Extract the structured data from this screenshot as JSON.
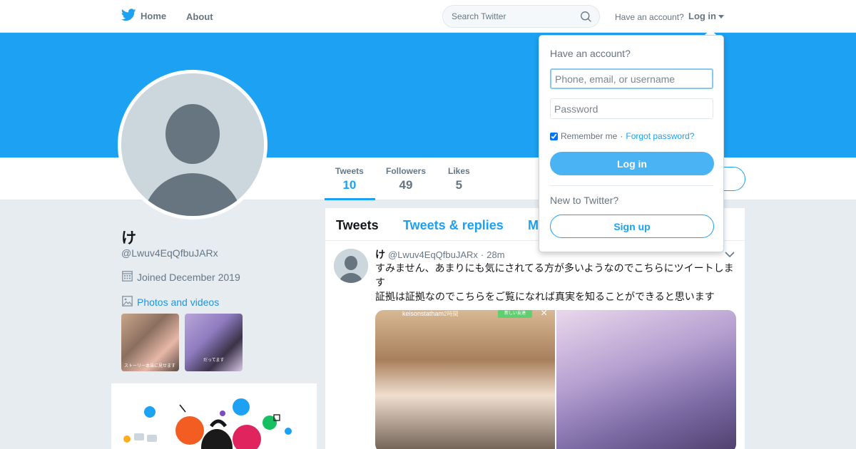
{
  "nav": {
    "home_label": "Home",
    "about_label": "About",
    "search_placeholder": "Search Twitter",
    "have_account_text": "Have an account?",
    "login_label": "Log in"
  },
  "profile": {
    "name": "け",
    "handle": "@Lwuv4EqQfbuJARx",
    "joined": "Joined December 2019",
    "photos_link": "Photos and videos",
    "thumb1_caption": "ストーリー本当に見せます",
    "thumb2_caption": "だってます"
  },
  "stats": [
    {
      "label": "Tweets",
      "value": "10"
    },
    {
      "label": "Followers",
      "value": "49"
    },
    {
      "label": "Likes",
      "value": "5"
    }
  ],
  "timeline": {
    "tabs": [
      "Tweets",
      "Tweets & replies",
      "M"
    ],
    "tweet": {
      "name": "け",
      "handle": "@Lwuv4EqQfbuJARx",
      "sep": "·",
      "time": "28m",
      "line1": "すみません、あまりにも気にされてる方が多いようなのでこちらにツイートしま",
      "line2": "す",
      "line3": "証拠は証拠なのでこちらをご覧になれば真実を知ることができると思います",
      "media_username": "keisonstatham",
      "media_time": "2時間",
      "media_badge": "新しい友達"
    }
  },
  "login_dropdown": {
    "title": "Have an account?",
    "username_placeholder": "Phone, email, or username",
    "password_placeholder": "Password",
    "remember_label": "Remember me",
    "separator": "·",
    "forgot_label": "Forgot password?",
    "login_button": "Log in",
    "new_to_twitter": "New to Twitter?",
    "signup_button": "Sign up"
  },
  "colors": {
    "brand": "#1da1f2",
    "background": "#e6ecf0",
    "muted": "#657786"
  },
  "icons": [
    "twitter-bird-icon",
    "search-icon",
    "caret-down-icon",
    "calendar-icon",
    "image-icon",
    "chevron-down-icon",
    "default-avatar-icon"
  ]
}
